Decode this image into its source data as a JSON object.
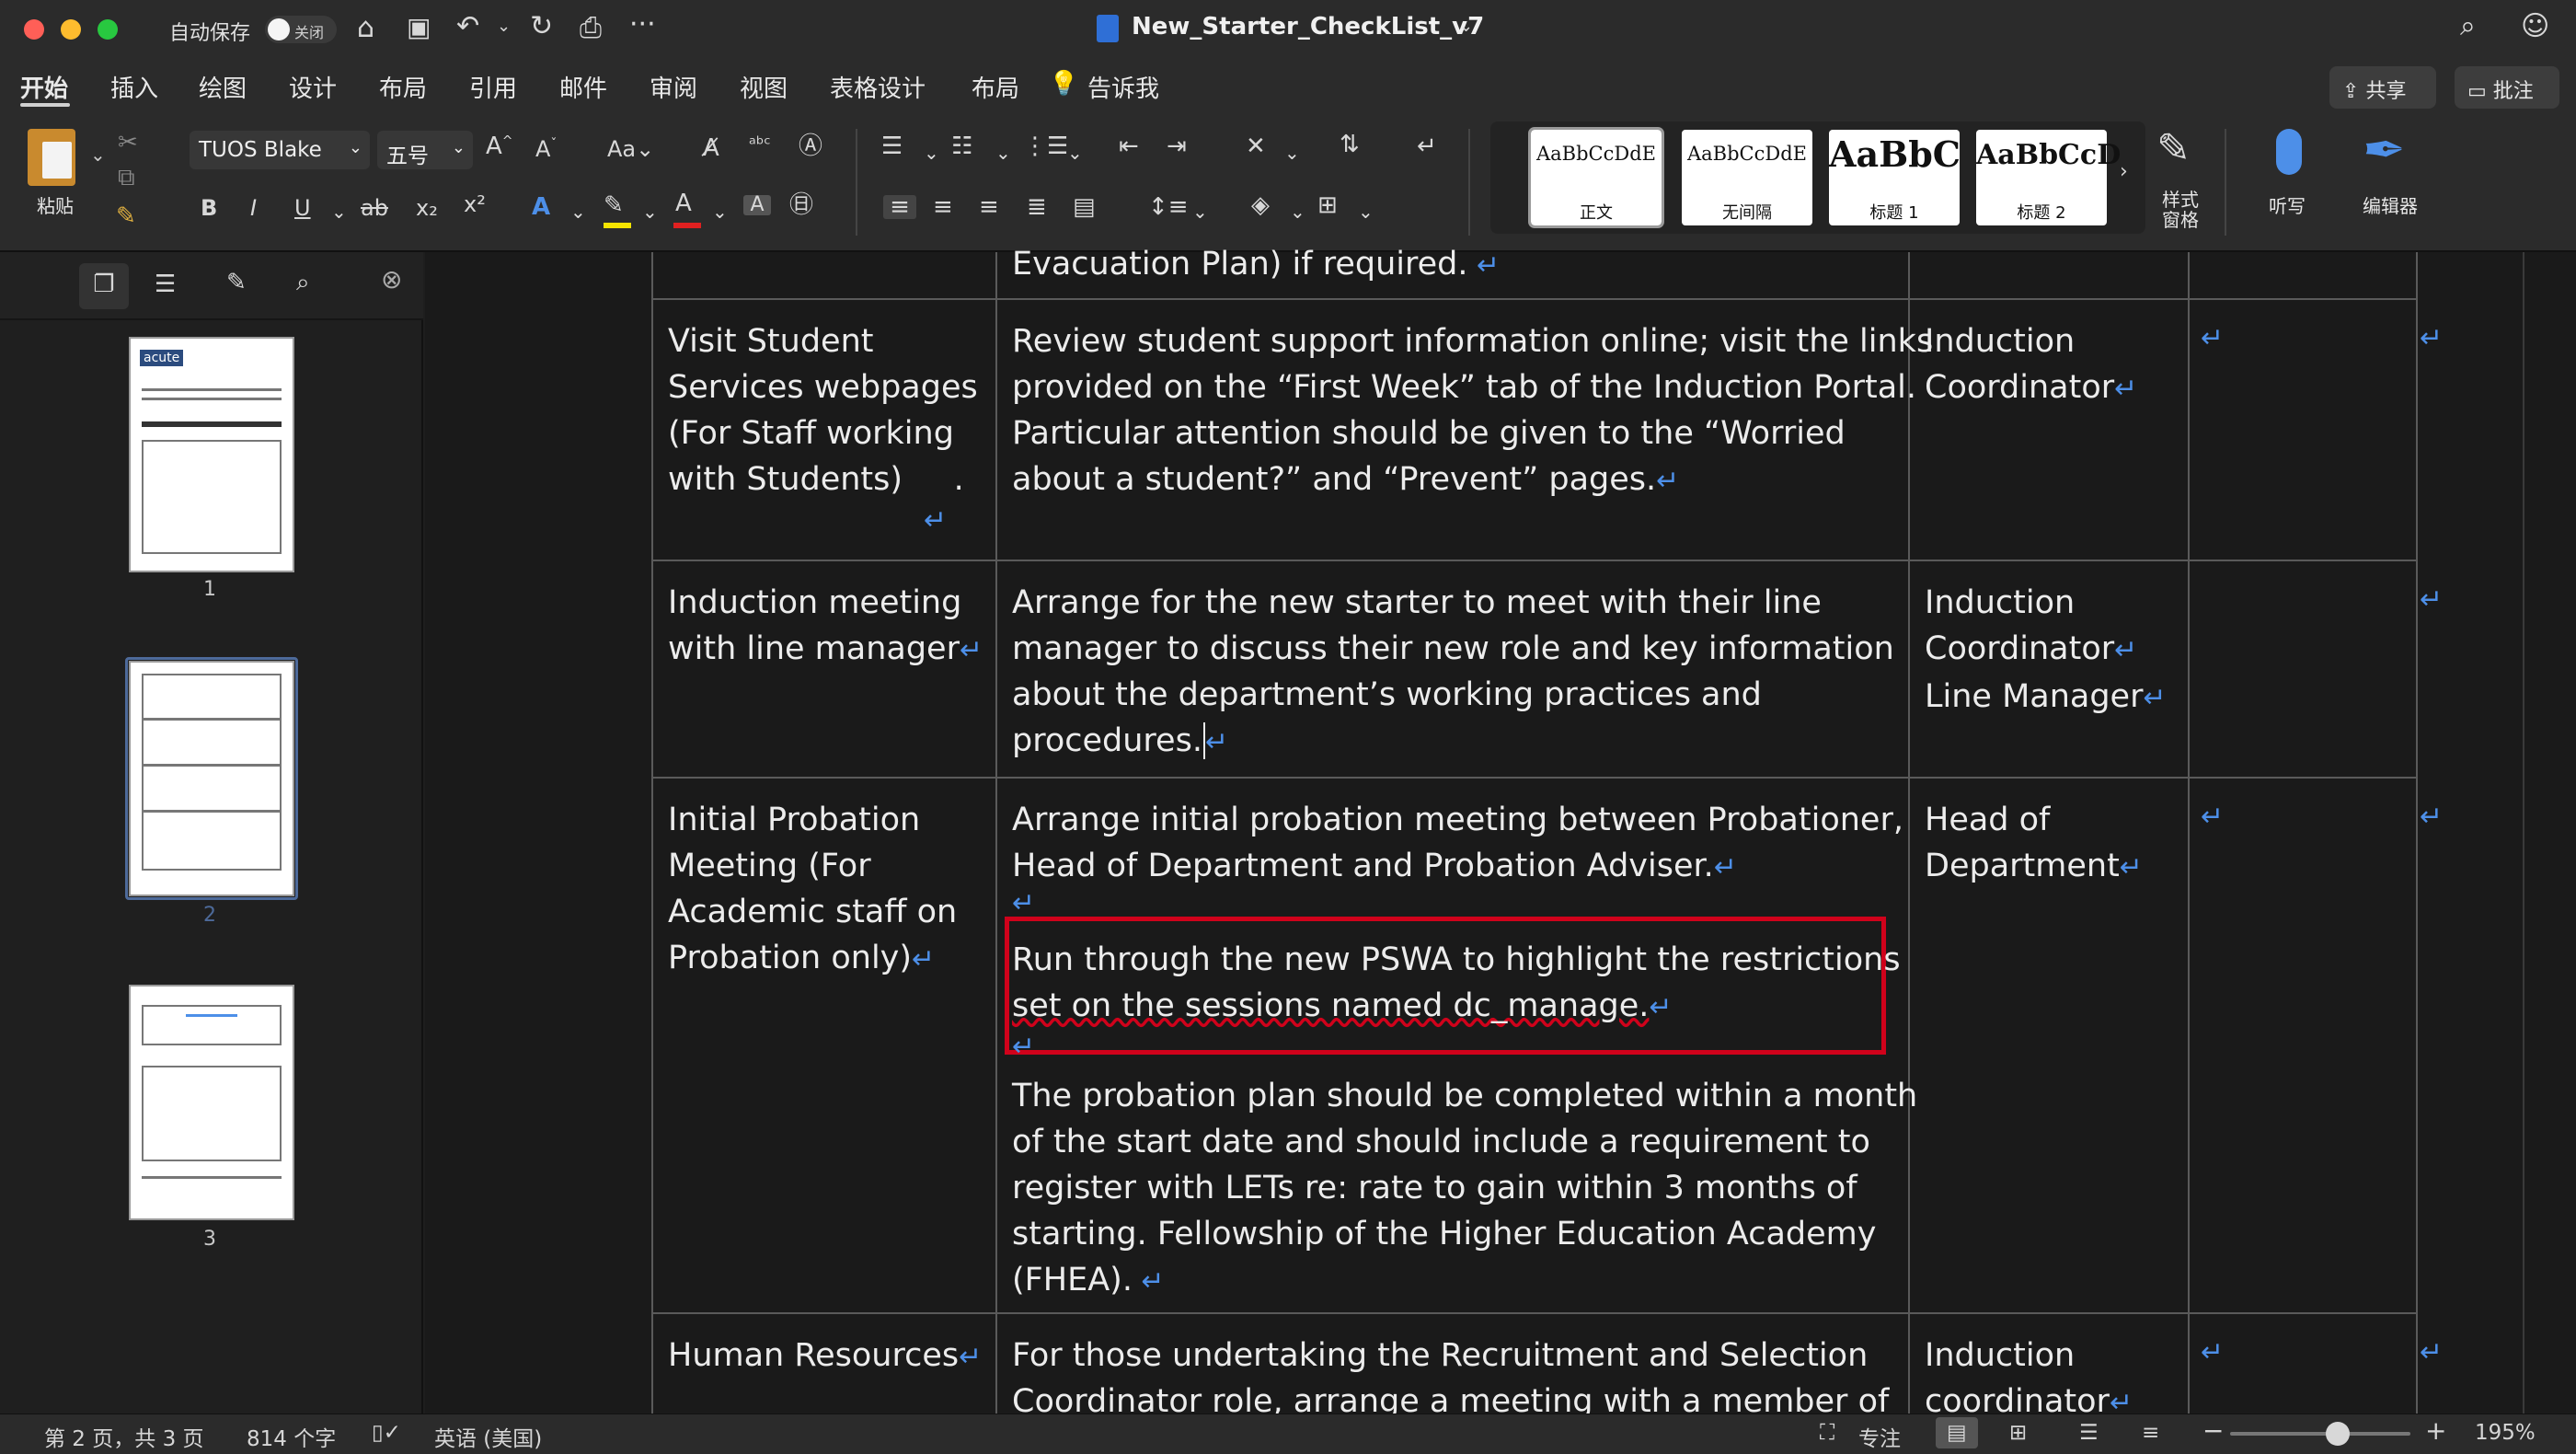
{
  "window": {
    "autosave_label": "自动保存",
    "autosave_state": "关闭",
    "doc_title": "New_Starter_CheckList_v7"
  },
  "menu": {
    "tabs": [
      "开始",
      "插入",
      "绘图",
      "设计",
      "布局",
      "引用",
      "邮件",
      "审阅",
      "视图",
      "表格设计",
      "布局"
    ],
    "tell_me": "告诉我",
    "share": "共享",
    "comments": "批注"
  },
  "ribbon": {
    "paste": "粘贴",
    "font_name": "TUOS Blake",
    "font_size": "五号",
    "styles": [
      {
        "sample": "AaBbCcDdE",
        "name": "正文"
      },
      {
        "sample": "AaBbCcDdE",
        "name": "无间隔"
      },
      {
        "sample": "AaBbC",
        "name": "标题 1"
      },
      {
        "sample": "AaBbCcD",
        "name": "标题 2"
      }
    ],
    "styles_pane": "样式\n窗格",
    "dictate": "听写",
    "editor": "编辑器"
  },
  "nav": {
    "pages": [
      "1",
      "2",
      "3"
    ],
    "thumb1_logo": "acute"
  },
  "table": {
    "top_fragment": "Evacuation Plan) if required.",
    "rows": [
      {
        "task": [
          "Visit Student",
          "Services webpages",
          "(For Staff working",
          "with Students)     ."
        ],
        "detail": [
          "Review student support information online; visit the links",
          "provided on the “First Week” tab of the Induction Portal.",
          "Particular attention should be given to the “Worried",
          "about a student?” and “Prevent” pages."
        ],
        "responsible": [
          "Induction",
          "Coordinator"
        ]
      },
      {
        "task": [
          "Induction meeting",
          "with line manager"
        ],
        "detail": [
          "Arrange for the new starter to meet with their line",
          "manager to discuss their new role and key information",
          "about the department’s working practices and",
          "procedures."
        ],
        "responsible": [
          "Induction",
          "Coordinator",
          "Line Manager"
        ]
      },
      {
        "task": [
          "Initial Probation",
          "Meeting (For",
          "Academic staff on",
          "Probation only)"
        ],
        "detail_a": [
          "Arrange initial probation meeting between Probationer,",
          "Head of Department and Probation Adviser."
        ],
        "detail_highlight": [
          "Run through the new PSWA to highlight the restrictions",
          "set on the sessions named dc_manage."
        ],
        "detail_b": [
          "The probation plan should be completed within a month",
          "of the start date and should include a requirement to",
          "register with LETs re: rate to gain within 3 months of",
          "starting. Fellowship of the Higher Education Academy",
          "(FHEA)."
        ],
        "responsible": [
          "Head of",
          "Department"
        ]
      },
      {
        "task": [
          "Human Resources"
        ],
        "detail": [
          "For those undertaking the Recruitment and Selection",
          "Coordinator role, arrange a meeting with a member of"
        ],
        "responsible": [
          "Induction",
          "coordinator"
        ]
      }
    ]
  },
  "status": {
    "page": "第 2 页，共 3 页",
    "words": "814 个字",
    "language": "英语 (美国)",
    "focus": "专注",
    "zoom": "195%"
  },
  "colors": {
    "highlight_border": "#d0021b",
    "paragraph_mark": "#4d8fe8",
    "font_color_bar": "#e02020",
    "highlight_color_bar": "#f5e400"
  }
}
